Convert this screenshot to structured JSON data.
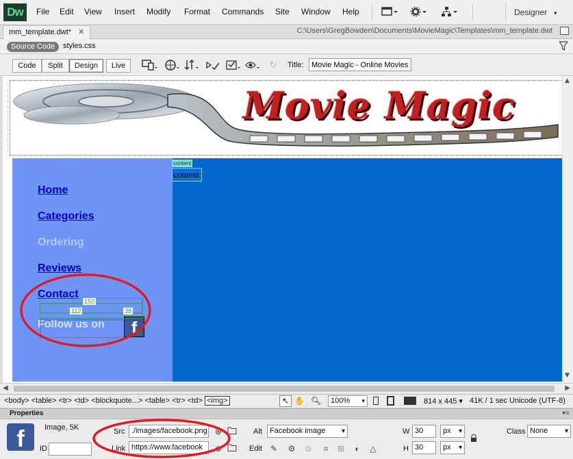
{
  "app": {
    "logo": "Dw",
    "workspace": "Designer"
  },
  "menu": [
    "File",
    "Edit",
    "View",
    "Insert",
    "Modify",
    "Format",
    "Commands",
    "Site",
    "Window",
    "Help"
  ],
  "toolbar_icons": [
    "layout-icon",
    "gear-icon",
    "site-structure-icon"
  ],
  "document": {
    "tab": "mm_template.dwt*",
    "path": "C:\\Users\\GregBowden\\Documents\\MovieMagic\\Templates\\mm_template.dwt"
  },
  "related_files": {
    "source_code": "Source Code",
    "styles": "styles.css"
  },
  "views": [
    "Code",
    "Split",
    "Design",
    "Live"
  ],
  "active_view": "Design",
  "page_title": {
    "label": "Title:",
    "value": "Movie Magic - Online Movies"
  },
  "page": {
    "logo_text": "Movie Magic",
    "nav": [
      "Home",
      "Categories",
      "Ordering",
      "Reviews",
      "Contact"
    ],
    "follow": "Follow us on",
    "fb_glyph": "f",
    "content_tag": "content",
    "content_text": "content",
    "guides": {
      "width": "150",
      "left": "112",
      "right": "38"
    }
  },
  "status": {
    "tags": "<body> <table> <tr> <td> <blockquote...> <table> <tr> <td>",
    "current_tag": "<img>",
    "zoom": "100%",
    "window_size": "814 x 445",
    "download": "41K / 1 sec",
    "encoding": "Unicode (UTF-8)"
  },
  "properties": {
    "title": "Properties",
    "kind": "Image, 5K",
    "id_label": "ID",
    "id_value": "",
    "src_label": "Src",
    "src_value": "./images/facebook.png",
    "link_label": "Link",
    "link_value": "https://www.facebook",
    "alt_label": "Alt",
    "alt_value": "Facebook image",
    "edit_label": "Edit",
    "w_label": "W",
    "w_value": "30",
    "h_label": "H",
    "h_value": "30",
    "unit": "px",
    "class_label": "Class",
    "class_value": "None"
  },
  "colors": {
    "sidebar": "#6f94f7",
    "content": "#0566cf",
    "annotation": "#e01b24"
  }
}
